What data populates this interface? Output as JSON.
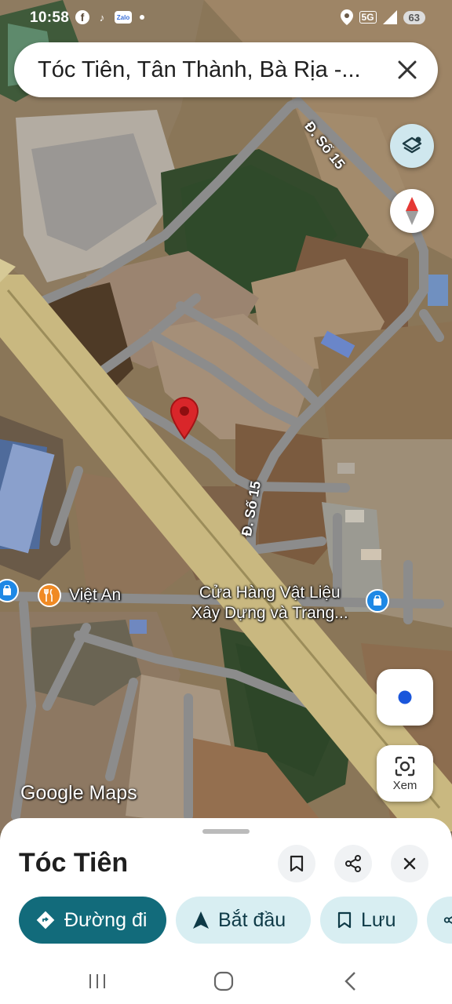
{
  "status_bar": {
    "time": "10:58",
    "network": "5G",
    "battery": "63",
    "icons": [
      "facebook-icon",
      "tiktok-icon",
      "zalo-icon",
      "location-icon"
    ],
    "zalo_text": "Zalo"
  },
  "search": {
    "query": "Tóc Tiên, Tân Thành, Bà Rịa -..."
  },
  "map": {
    "road_label_top": "Đ. Số 15",
    "road_label_mid": "Đ. Số 15",
    "poi_restaurant": "Việt An",
    "poi_store": "Cửa Hàng Vật Liệu\nXây Dựng và Trang...",
    "watermark": "Google Maps",
    "lens_label": "Xem"
  },
  "sheet": {
    "title": "Tóc Tiên",
    "chips": {
      "directions": "Đường đi",
      "start": "Bắt đầu",
      "save": "Lưu"
    }
  },
  "colors": {
    "primary": "#126b7b",
    "chip_bg": "#d8eef2",
    "pin": "#d9262a",
    "highway": "#c9b880"
  }
}
